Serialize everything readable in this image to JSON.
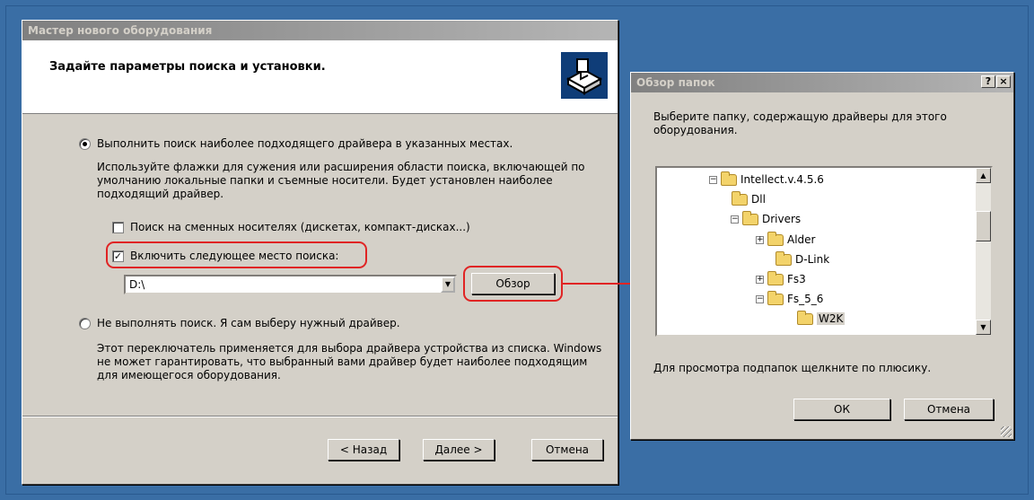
{
  "wizard": {
    "title": "Мастер нового оборудования",
    "header_title": "Задайте параметры поиска и установки.",
    "option_search_label": "Выполнить поиск наиболее подходящего драйвера в указанных местах.",
    "option_search_desc": "Используйте флажки для сужения или расширения области поиска, включающей по умолчанию локальные папки и съемные носители. Будет установлен наиболее подходящий драйвер.",
    "checkbox_removable_label": "Поиск на сменных носителях (дискетах, компакт-дисках...)",
    "checkbox_include_label": "Включить следующее место поиска:",
    "path_value": "D:\\",
    "browse_button": "Обзор",
    "option_manual_label": "Не выполнять поиск. Я сам выберу нужный драйвер.",
    "option_manual_desc": "Этот переключатель применяется для выбора драйвера устройства из списка. Windows не может гарантировать, что выбранный вами драйвер будет наиболее подходящим для имеющегося оборудования.",
    "back_button": "< Назад",
    "next_button": "Далее >",
    "cancel_button": "Отмена",
    "check_mark": "✓"
  },
  "browse_dialog": {
    "title": "Обзор папок",
    "help_button": "?",
    "close_button": "×",
    "instruction": "Выберите папку, содержащую драйверы для этого оборудования.",
    "tree": [
      {
        "label": "Intellect.v.4.5.6",
        "expander": "−"
      },
      {
        "label": "Dll",
        "expander": ""
      },
      {
        "label": "Drivers",
        "expander": "−"
      },
      {
        "label": "Alder",
        "expander": "+"
      },
      {
        "label": "D-Link",
        "expander": ""
      },
      {
        "label": "Fs3",
        "expander": "+"
      },
      {
        "label": "Fs_5_6",
        "expander": "−"
      },
      {
        "label": "W2K",
        "expander": "",
        "selected": true
      }
    ],
    "hint": "Для просмотра подпапок щелкните по плюсику.",
    "ok_button": "ОК",
    "cancel_button": "Отмена"
  },
  "colors": {
    "desktop": "#3a6ea5",
    "highlight": "#e02424"
  }
}
